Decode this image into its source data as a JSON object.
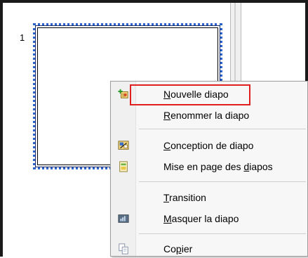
{
  "slide_pane": {
    "slide_number": "1"
  },
  "context_menu": {
    "items": [
      {
        "pre": "",
        "u": "N",
        "post": "ouvelle diapo",
        "icon": "new-slide-icon",
        "highlighted": true
      },
      {
        "pre": "",
        "u": "R",
        "post": "enommer la diapo",
        "icon": "",
        "highlighted": false
      },
      {
        "pre": "",
        "u": "C",
        "post": "onception de diapo",
        "icon": "slide-design-icon",
        "highlighted": false
      },
      {
        "pre": "Mise en page des ",
        "u": "d",
        "post": "iapos",
        "icon": "slide-layout-icon",
        "highlighted": false
      },
      {
        "pre": "",
        "u": "T",
        "post": "ransition",
        "icon": "",
        "highlighted": false
      },
      {
        "pre": "",
        "u": "M",
        "post": "asquer la diapo",
        "icon": "hide-slide-icon",
        "highlighted": false
      },
      {
        "pre": "Co",
        "u": "p",
        "post": "ier",
        "icon": "copy-icon",
        "highlighted": false
      }
    ]
  },
  "colors": {
    "selection_border": "#2a63c9",
    "highlight": "#e02020",
    "menu_bg": "#f7f7f7"
  }
}
